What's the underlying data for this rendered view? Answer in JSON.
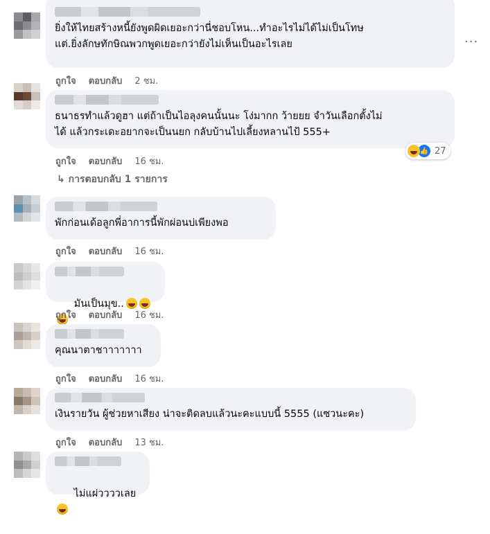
{
  "labels": {
    "like": "ถูกใจ",
    "reply": "ตอบกลับ"
  },
  "comments": [
    {
      "text": "ยิ่งให้ไทยสร้างหนี้ยังพูดผิดเยอะกว่านี่ชอบโหน...ทำอะไรไม่ได้ไม่เป็นโทษ\nแต่.ยิ่งลักษทักษิณพวกพูดเยอะกว่ายังไม่เห็นเป็นอะไรเลย",
      "time": "2 ชม."
    },
    {
      "text": "ธนาธรทำแล้วดูฮา แต่ถ้าเป็นไอลุงคนนั้นนะ โง่มากก ว้ายยย จำวันเลือกตั้งไม่\nได้ แล้วกระเดะอยากจะเป็นนยก กลับบ้านไปเลี้ยงหลานไป้ 555+",
      "time": "16 ชม.",
      "reaction_count": "27",
      "replies_link": "↳ การตอบกลับ 1 รายการ"
    },
    {
      "text": "พักก่อนเด้อลูกพี่อาการนี้พักผ่อนบ่เพียงพอ",
      "time": "16 ชม."
    },
    {
      "text": "มันเป็นมุข..",
      "time": "16 ชม.",
      "emoji": [
        "grinning-squint-face-icon",
        "grinning-squint-face-icon",
        "grinning-squint-face-icon"
      ]
    },
    {
      "text": "คุณนาตาชาาาาาาา",
      "time": "16 ชม."
    },
    {
      "text": "เงินรายวัน ผู้ช่วยหาเสียง น่าจะติดลบแล้วนะคะแบบนี้ 5555 (แซวนะคะ)",
      "time": "13 ชม."
    },
    {
      "text": "ไม่แผ่ววววเลย",
      "emoji": [
        "tears-of-joy-icon"
      ]
    }
  ],
  "more_options": "···"
}
